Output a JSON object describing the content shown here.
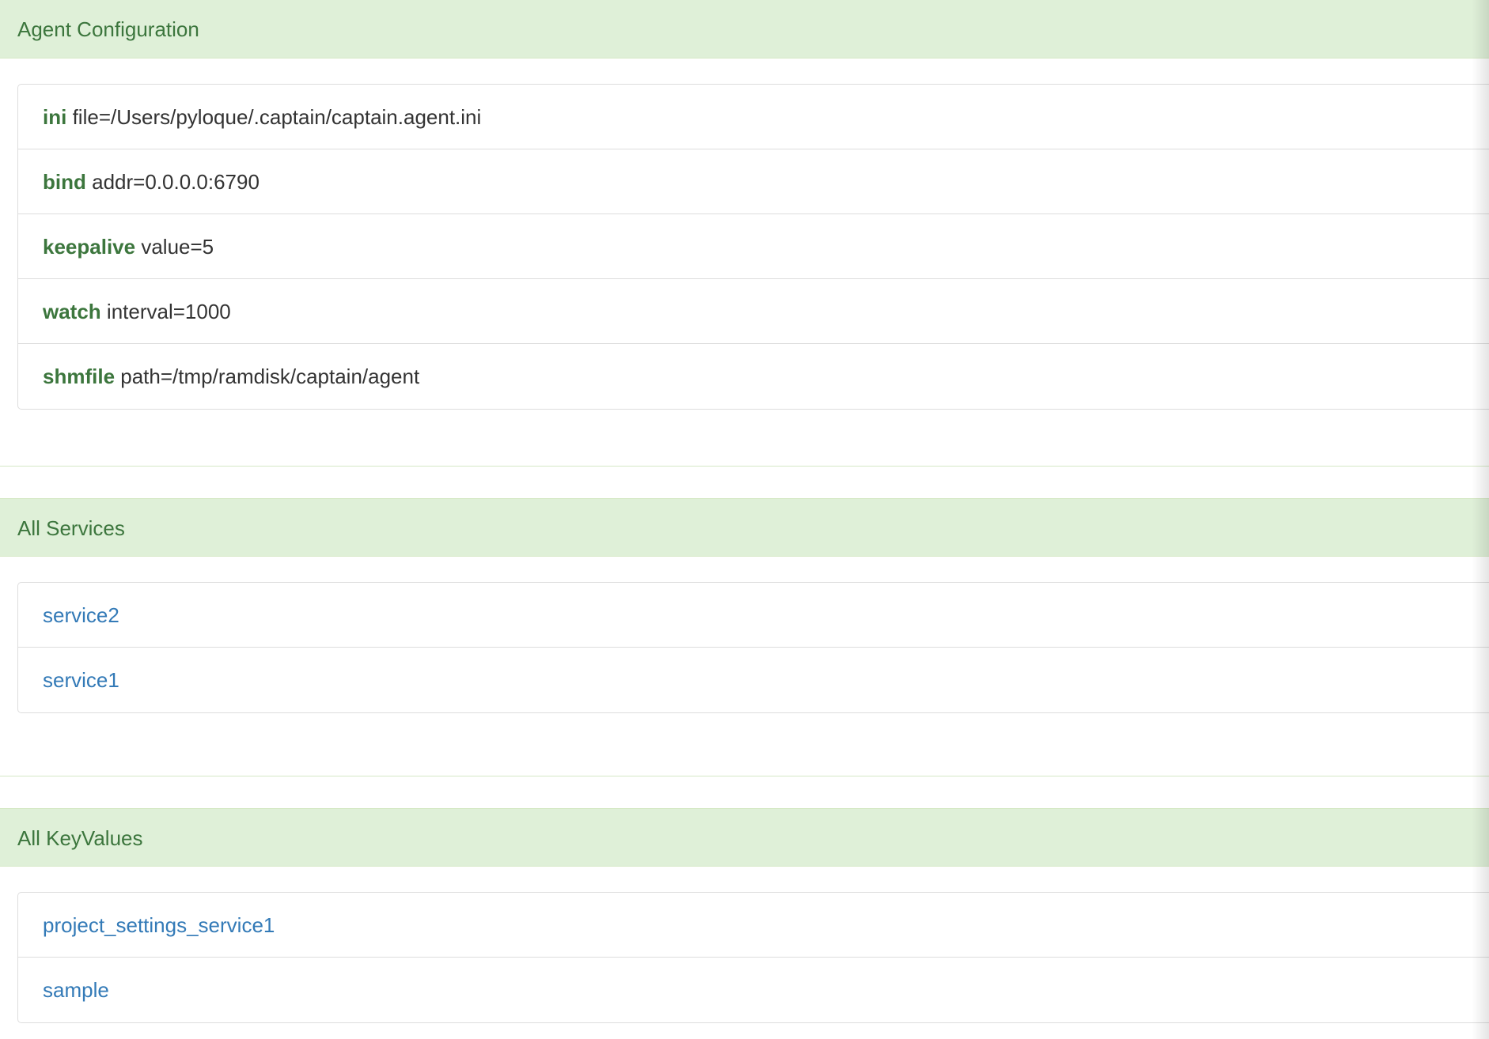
{
  "agent_config": {
    "title": "Agent Configuration",
    "items": [
      {
        "key": "ini",
        "value": "file=/Users/pyloque/.captain/captain.agent.ini"
      },
      {
        "key": "bind",
        "value": "addr=0.0.0.0:6790"
      },
      {
        "key": "keepalive",
        "value": "value=5"
      },
      {
        "key": "watch",
        "value": "interval=1000"
      },
      {
        "key": "shmfile",
        "value": "path=/tmp/ramdisk/captain/agent"
      }
    ]
  },
  "services": {
    "title": "All Services",
    "items": [
      "service2",
      "service1"
    ]
  },
  "keyvalues": {
    "title": "All KeyValues",
    "items": [
      "project_settings_service1",
      "sample"
    ]
  }
}
